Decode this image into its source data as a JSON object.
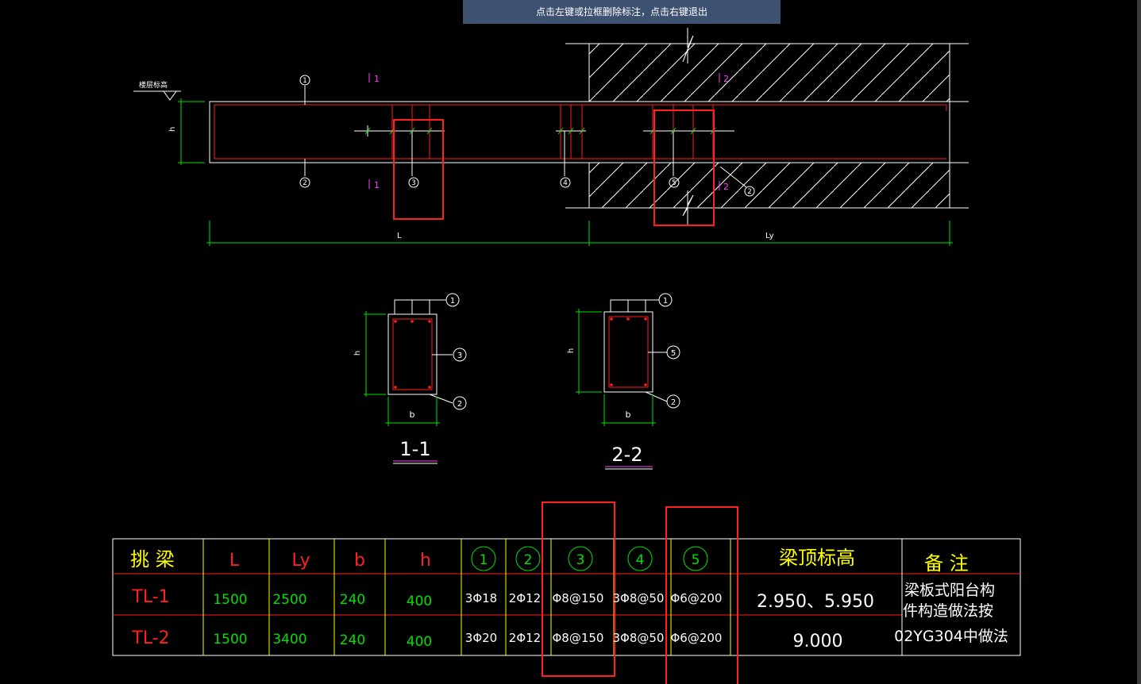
{
  "status_tip": "点击左键或拉框删除标注，点击右键退出",
  "elevation_label": "楼层标高",
  "dim_labels": {
    "h": "h",
    "L": "L",
    "Ly": "Ly",
    "b": "b"
  },
  "rebar_marks": [
    "1",
    "2",
    "3",
    "4",
    "5"
  ],
  "section_marks": {
    "top_left": "1",
    "bottom_left": "1",
    "top_right": "2",
    "bottom_right": "2"
  },
  "section_titles": {
    "s1": "1-1",
    "s2": "2-2"
  },
  "table": {
    "headers": [
      "挑 梁",
      "L",
      "Ly",
      "b",
      "h",
      "1",
      "2",
      "3",
      "4",
      "5",
      "梁顶标高",
      "备 注"
    ],
    "rows": [
      {
        "name": "TL-1",
        "L": "1500",
        "Ly": "2500",
        "b": "240",
        "h": "400",
        "r1": "3Φ18",
        "r2": "2Φ12",
        "r3": "Φ8@150",
        "r4": "3Φ8@50",
        "r5": "Φ6@200",
        "elev": "2.950、5.950"
      },
      {
        "name": "TL-2",
        "L": "1500",
        "Ly": "3400",
        "b": "240",
        "h": "400",
        "r1": "3Φ20",
        "r2": "2Φ12",
        "r3": "Φ8@150",
        "r4": "3Φ8@50",
        "r5": "Φ6@200",
        "elev": "9.000"
      }
    ],
    "remark_lines": [
      "梁板式阳台构",
      "件构造做法按",
      "02YG304中做法"
    ]
  },
  "colors": {
    "bg": "#000000",
    "white": "#ffffff",
    "red": "#ff2020",
    "green": "#00e000",
    "yellow": "#ffff00",
    "magenta": "#ff40ff",
    "tip_bg": "#3d5170"
  }
}
